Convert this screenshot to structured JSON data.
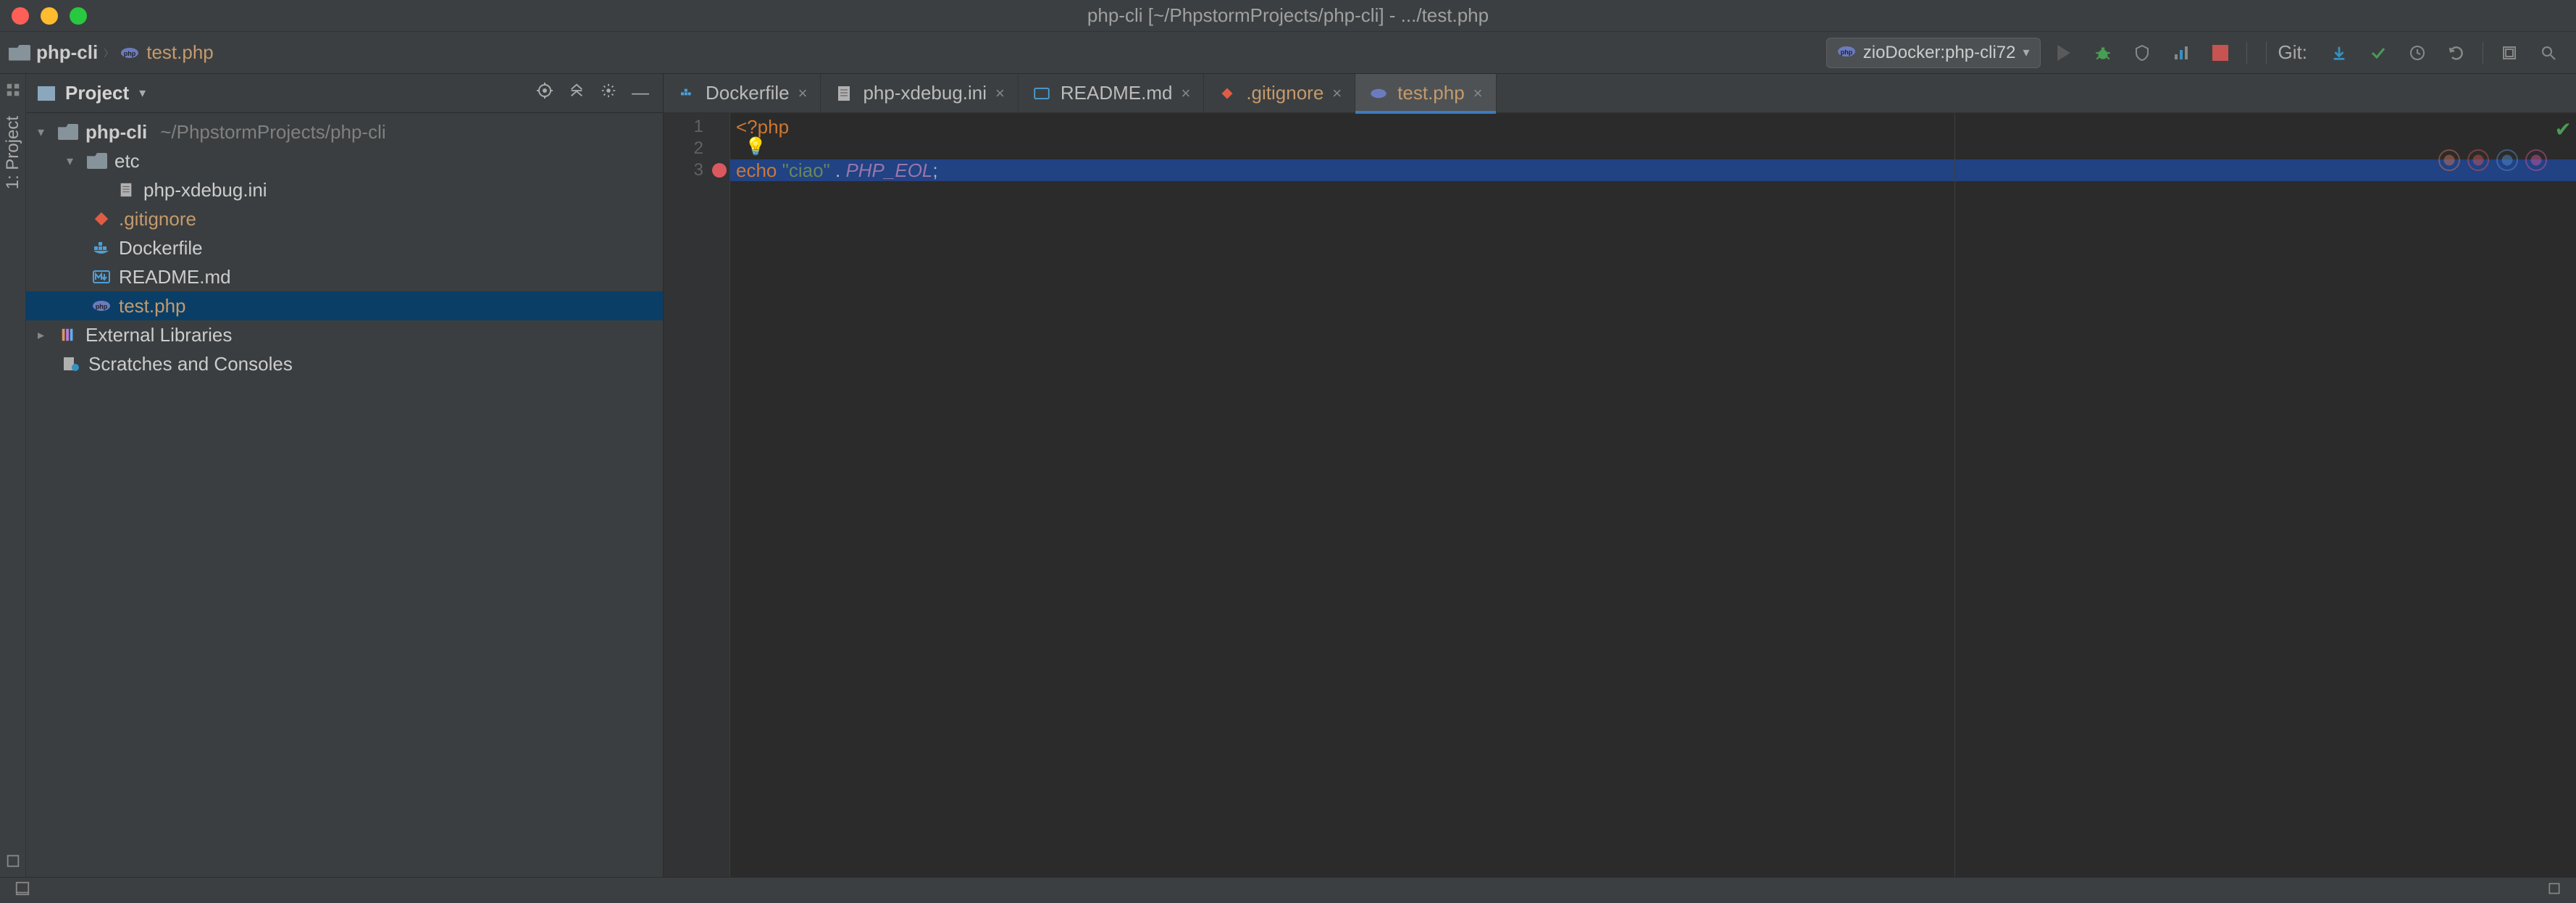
{
  "window": {
    "title": "php-cli [~/PhpstormProjects/php-cli] - .../test.php"
  },
  "breadcrumbs": {
    "root": "php-cli",
    "file": "test.php"
  },
  "run_config": {
    "label": "zioDocker:php-cli72"
  },
  "git_label": "Git:",
  "project_panel": {
    "title": "Project"
  },
  "tree": {
    "root": {
      "name": "php-cli",
      "path": "~/PhpstormProjects/php-cli"
    },
    "etc": "etc",
    "xdebug_ini": "php-xdebug.ini",
    "gitignore": ".gitignore",
    "dockerfile": "Dockerfile",
    "readme": "README.md",
    "testphp": "test.php",
    "ext_libs": "External Libraries",
    "scratches": "Scratches and Consoles"
  },
  "tabs": [
    {
      "label": "Dockerfile",
      "color": "normal"
    },
    {
      "label": "php-xdebug.ini",
      "color": "normal"
    },
    {
      "label": "README.md",
      "color": "normal"
    },
    {
      "label": ".gitignore",
      "color": "orange"
    },
    {
      "label": "test.php",
      "color": "orange",
      "active": true
    }
  ],
  "code": {
    "line1": "<?php",
    "line3_echo": "echo ",
    "line3_str": "\"ciao\"",
    "line3_dot": " . ",
    "line3_const": "PHP_EOL",
    "line3_semi": ";"
  },
  "gutter_lines": [
    "1",
    "2",
    "3"
  ],
  "left_gutter": {
    "project_label": "1: Project"
  },
  "status": {
    "left": ""
  }
}
